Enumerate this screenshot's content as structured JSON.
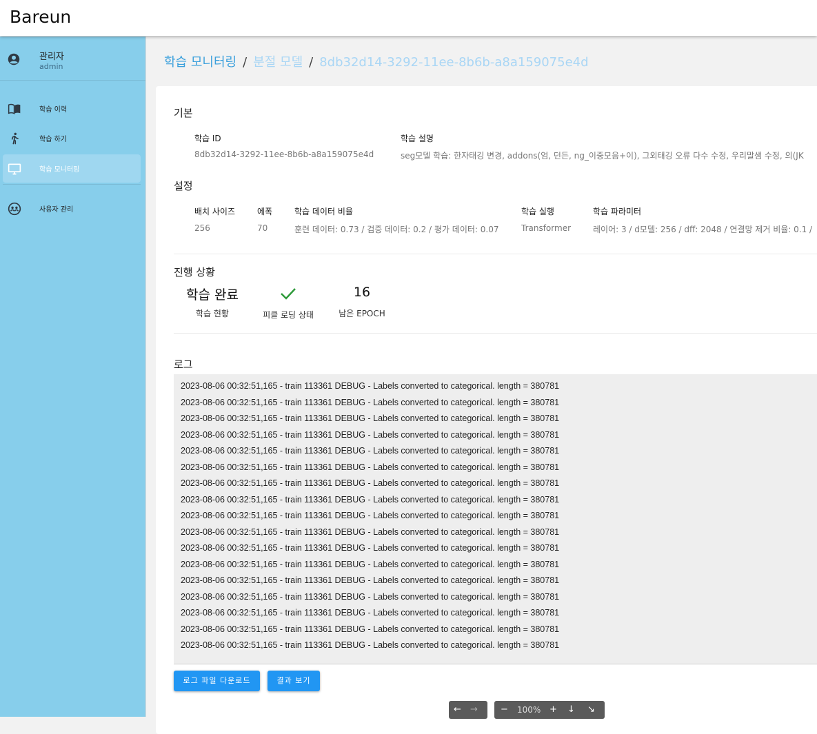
{
  "app": {
    "brand": "Bareun"
  },
  "sidebar": {
    "profile": {
      "name": "관리자",
      "id": "admin"
    },
    "items": [
      {
        "label": "학습 이력",
        "icon": "book-icon",
        "active": false
      },
      {
        "label": "학습 하기",
        "icon": "run-icon",
        "active": false
      },
      {
        "label": "학습 모니터링",
        "icon": "monitor-icon",
        "active": true
      },
      {
        "label": "사용자 관리",
        "icon": "users-icon",
        "active": false
      }
    ]
  },
  "breadcrumb": {
    "items": [
      "학습 모니터링",
      "분절 모델",
      "8db32d14-3292-11ee-8b6b-a8a159075e4d"
    ],
    "separator": "/"
  },
  "basic": {
    "title": "기본",
    "id_label": "학습 ID",
    "id_value": "8db32d14-3292-11ee-8b6b-a8a159075e4d",
    "desc_label": "학습 설명",
    "desc_value": "seg모델 학습: 한자태깅 변경, addons(엄, 던든, ng_이중모음+이), 그외태깅 오류 다수 수정, 우리말샘 수정, 의(JK"
  },
  "settings": {
    "title": "설정",
    "batch_label": "배치 사이즈",
    "batch_value": "256",
    "epoch_label": "에폭",
    "epoch_value": "70",
    "ratio_label": "학습 데이터 비율",
    "ratio_value": "훈련 데이터: 0.73 / 검증 데이터: 0.2 / 평가 데이터: 0.07",
    "run_label": "학습 실행",
    "run_value": "Transformer",
    "param_label": "학습 파라미터",
    "param_value": "레이어: 3 / d모델: 256 / dff: 2048 / 연결망 제거 비율: 0.1 /"
  },
  "progress": {
    "title": "진행 상황",
    "status_value": "학습 완료",
    "status_label": "학습 현황",
    "pickle_label": "피클 로딩 상태",
    "pickle_ok": true,
    "remaining_value": "16",
    "remaining_label": "남은 EPOCH"
  },
  "log": {
    "title": "로그",
    "lines": [
      "2023-08-06 00:32:51,165 - train 113361 DEBUG - Labels converted to categorical. length = 380781",
      "2023-08-06 00:32:51,165 - train 113361 DEBUG - Labels converted to categorical. length = 380781",
      "2023-08-06 00:32:51,165 - train 113361 DEBUG - Labels converted to categorical. length = 380781",
      "2023-08-06 00:32:51,165 - train 113361 DEBUG - Labels converted to categorical. length = 380781",
      "2023-08-06 00:32:51,165 - train 113361 DEBUG - Labels converted to categorical. length = 380781",
      "2023-08-06 00:32:51,165 - train 113361 DEBUG - Labels converted to categorical. length = 380781",
      "2023-08-06 00:32:51,165 - train 113361 DEBUG - Labels converted to categorical. length = 380781",
      "2023-08-06 00:32:51,165 - train 113361 DEBUG - Labels converted to categorical. length = 380781",
      "2023-08-06 00:32:51,165 - train 113361 DEBUG - Labels converted to categorical. length = 380781",
      "2023-08-06 00:32:51,165 - train 113361 DEBUG - Labels converted to categorical. length = 380781",
      "2023-08-06 00:32:51,165 - train 113361 DEBUG - Labels converted to categorical. length = 380781",
      "2023-08-06 00:32:51,165 - train 113361 DEBUG - Labels converted to categorical. length = 380781",
      "2023-08-06 00:32:51,165 - train 113361 DEBUG - Labels converted to categorical. length = 380781",
      "2023-08-06 00:32:51,165 - train 113361 DEBUG - Labels converted to categorical. length = 380781",
      "2023-08-06 00:32:51,165 - train 113361 DEBUG - Labels converted to categorical. length = 380781",
      "2023-08-06 00:32:51,165 - train 113361 DEBUG - Labels converted to categorical. length = 380781",
      "2023-08-06 00:32:51,165 - train 113361 DEBUG - Labels converted to categorical. length = 380781"
    ],
    "download_label": "로그 파일 다운로드",
    "result_label": "결과 보기"
  },
  "viewer": {
    "zoom": "100%"
  },
  "colors": {
    "sidebar": "#87ceeb",
    "accent": "#2196f3",
    "check": "#2e9a3a"
  }
}
